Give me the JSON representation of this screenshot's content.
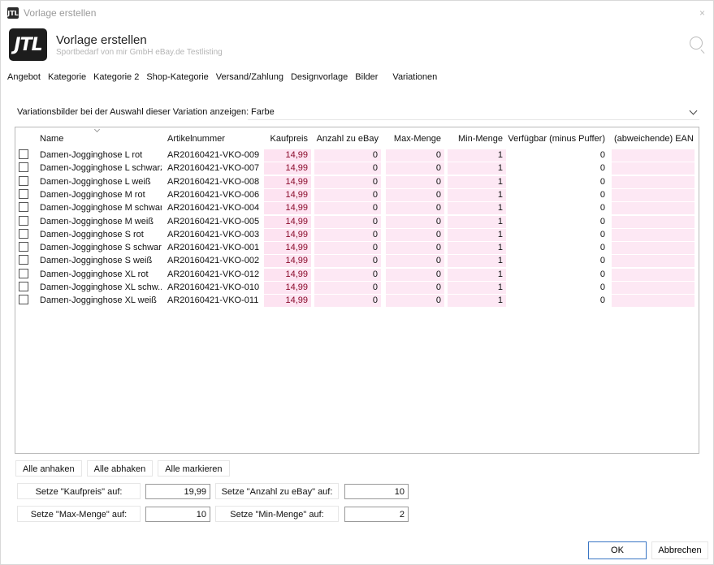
{
  "window": {
    "title": "Vorlage erstellen",
    "app_icon_text": "JTL",
    "close_glyph": "×"
  },
  "header": {
    "logo_text": "JTL",
    "title": "Vorlage erstellen",
    "subtitle": "Sportbedarf von mir GmbH eBay.de Testlisting"
  },
  "tabs": [
    {
      "label": "Angebot"
    },
    {
      "label": "Kategorie"
    },
    {
      "label": "Kategorie 2"
    },
    {
      "label": "Shop-Kategorie"
    },
    {
      "label": "Versand/Zahlung"
    },
    {
      "label": "Designvorlage"
    },
    {
      "label": "Bilder"
    },
    {
      "label": "Variationen"
    }
  ],
  "variation_images": {
    "label": "Variationsbilder bei der Auswahl dieser Variation anzeigen:",
    "selected": "Farbe"
  },
  "columns": {
    "name": "Name",
    "sku": "Artikelnummer",
    "price": "Kaufpreis",
    "ebay_qty": "Anzahl zu eBay",
    "max_qty": "Max-Menge",
    "min_qty": "Min-Menge",
    "available": "Verfügbar (minus Puffer)",
    "ean": "(abweichende) EAN"
  },
  "rows": [
    {
      "name": "Damen-Jogginghose L rot",
      "sku": "AR20160421-VKO-009",
      "price": "14,99",
      "ebay_qty": "0",
      "max_qty": "0",
      "min_qty": "1",
      "available": "0",
      "ean": ""
    },
    {
      "name": "Damen-Jogginghose L schwarz",
      "sku": "AR20160421-VKO-007",
      "price": "14,99",
      "ebay_qty": "0",
      "max_qty": "0",
      "min_qty": "1",
      "available": "0",
      "ean": ""
    },
    {
      "name": "Damen-Jogginghose L weiß",
      "sku": "AR20160421-VKO-008",
      "price": "14,99",
      "ebay_qty": "0",
      "max_qty": "0",
      "min_qty": "1",
      "available": "0",
      "ean": ""
    },
    {
      "name": "Damen-Jogginghose M rot",
      "sku": "AR20160421-VKO-006",
      "price": "14,99",
      "ebay_qty": "0",
      "max_qty": "0",
      "min_qty": "1",
      "available": "0",
      "ean": ""
    },
    {
      "name": "Damen-Jogginghose M schwarz",
      "sku": "AR20160421-VKO-004",
      "price": "14,99",
      "ebay_qty": "0",
      "max_qty": "0",
      "min_qty": "1",
      "available": "0",
      "ean": ""
    },
    {
      "name": "Damen-Jogginghose M weiß",
      "sku": "AR20160421-VKO-005",
      "price": "14,99",
      "ebay_qty": "0",
      "max_qty": "0",
      "min_qty": "1",
      "available": "0",
      "ean": ""
    },
    {
      "name": "Damen-Jogginghose S rot",
      "sku": "AR20160421-VKO-003",
      "price": "14,99",
      "ebay_qty": "0",
      "max_qty": "0",
      "min_qty": "1",
      "available": "0",
      "ean": ""
    },
    {
      "name": "Damen-Jogginghose S schwarz",
      "sku": "AR20160421-VKO-001",
      "price": "14,99",
      "ebay_qty": "0",
      "max_qty": "0",
      "min_qty": "1",
      "available": "0",
      "ean": ""
    },
    {
      "name": "Damen-Jogginghose S weiß",
      "sku": "AR20160421-VKO-002",
      "price": "14,99",
      "ebay_qty": "0",
      "max_qty": "0",
      "min_qty": "1",
      "available": "0",
      "ean": ""
    },
    {
      "name": "Damen-Jogginghose XL rot",
      "sku": "AR20160421-VKO-012",
      "price": "14,99",
      "ebay_qty": "0",
      "max_qty": "0",
      "min_qty": "1",
      "available": "0",
      "ean": ""
    },
    {
      "name": "Damen-Jogginghose XL schw...",
      "sku": "AR20160421-VKO-010",
      "price": "14,99",
      "ebay_qty": "0",
      "max_qty": "0",
      "min_qty": "1",
      "available": "0",
      "ean": ""
    },
    {
      "name": "Damen-Jogginghose XL weiß",
      "sku": "AR20160421-VKO-011",
      "price": "14,99",
      "ebay_qty": "0",
      "max_qty": "0",
      "min_qty": "1",
      "available": "0",
      "ean": ""
    }
  ],
  "actions": {
    "check_all": "Alle anhaken",
    "uncheck_all": "Alle abhaken",
    "select_all": "Alle markieren"
  },
  "setters": {
    "price_label": "Setze \"Kaufpreis\" auf:",
    "price_value": "19,99",
    "ebay_qty_label": "Setze \"Anzahl zu eBay\" auf:",
    "ebay_qty_value": "10",
    "max_label": "Setze \"Max-Menge\" auf:",
    "max_value": "10",
    "min_label": "Setze \"Min-Menge\" auf:",
    "min_value": "2"
  },
  "footer": {
    "ok": "OK",
    "cancel": "Abbrechen"
  },
  "colors": {
    "editable_cell_bg": "#fde3f1",
    "editable_cell_text": "#8a0a2a",
    "ok_border": "#3a76c4"
  }
}
